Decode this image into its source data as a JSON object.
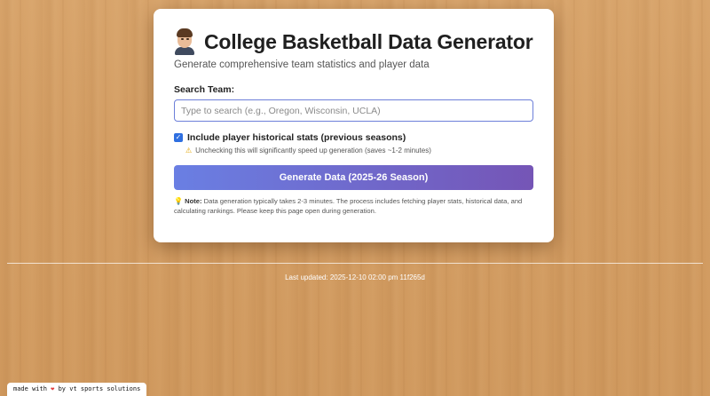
{
  "header": {
    "title": "College Basketball Data Generator",
    "subtitle": "Generate comprehensive team statistics and player data"
  },
  "search": {
    "label": "Search Team:",
    "placeholder": "Type to search (e.g., Oregon, Wisconsin, UCLA)",
    "value": ""
  },
  "options": {
    "historical_label": "Include player historical stats (previous seasons)",
    "historical_checked": true,
    "warning_text": "Unchecking this will significantly speed up generation (saves ~1-2 minutes)"
  },
  "actions": {
    "generate_label": "Generate Data (2025-26 Season)"
  },
  "note": {
    "prefix": "Note:",
    "text": "Data generation typically takes 2-3 minutes. The process includes fetching player stats, historical data, and calculating rankings. Please keep this page open during generation."
  },
  "footer": {
    "last_updated": "Last updated: 2025-12-10 02:00 pm 11f265d",
    "badge_prefix": "made with",
    "badge_suffix": "by vt sports solutions"
  },
  "colors": {
    "accent_start": "#6a7fe3",
    "accent_end": "#7555b6",
    "checkbox": "#2f6fe0"
  },
  "icons": {
    "avatar": "person-avatar-icon",
    "warning": "warning-icon",
    "note": "lightbulb-icon",
    "heart": "heart-icon"
  }
}
